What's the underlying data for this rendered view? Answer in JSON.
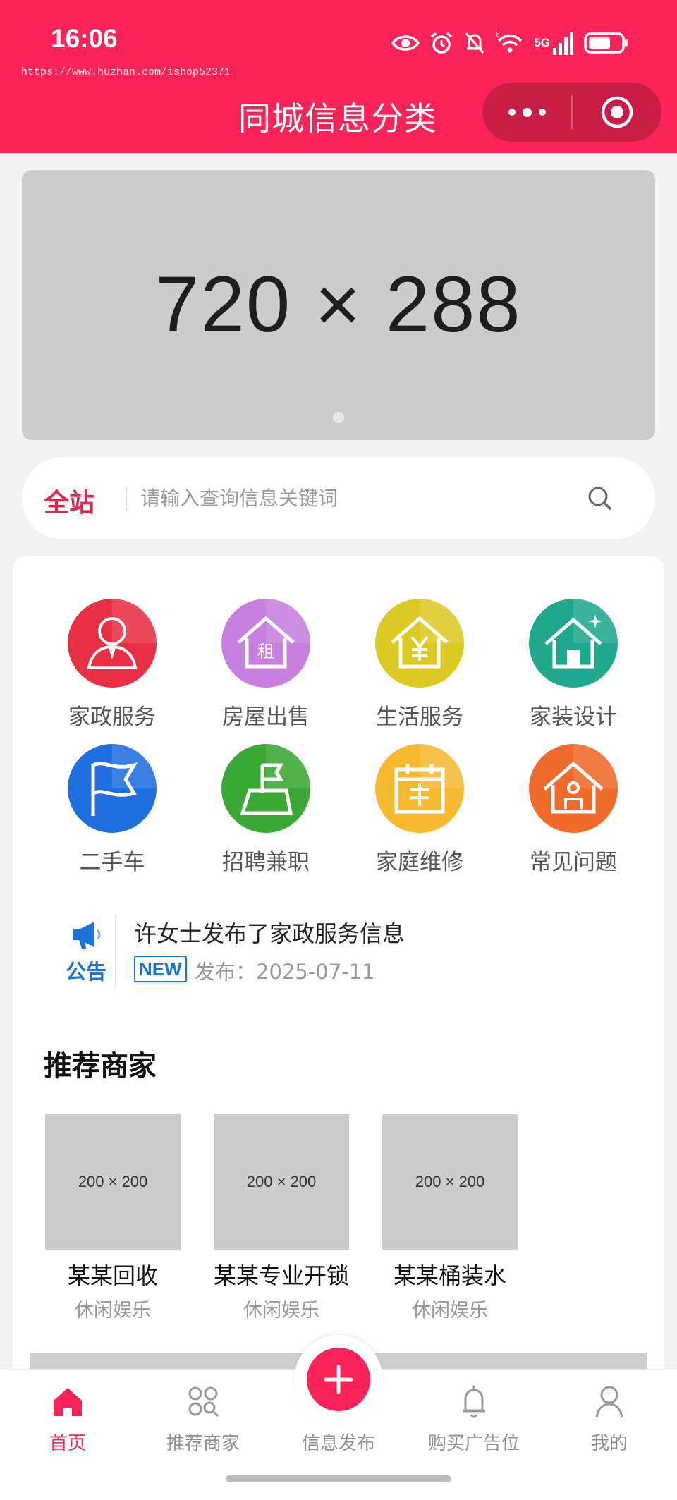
{
  "status_bar": {
    "time": "16:06",
    "network_label": "5G",
    "icons": [
      "eye-icon",
      "alarm-icon",
      "mute-bell-icon",
      "wifi-icon",
      "signal-icon",
      "battery-icon"
    ]
  },
  "url_watermark": "https://www.huzhan.com/ishop52371",
  "header": {
    "title": "同城信息分类",
    "more_icon": "more-dots-icon",
    "close_icon": "target-circle-icon",
    "bg_color": "#fc2358"
  },
  "banner": {
    "placeholder_text": "720 × 288"
  },
  "search": {
    "scope": "全站",
    "placeholder": "请输入查询信息关键词",
    "icon": "search-icon"
  },
  "categories": [
    {
      "label": "家政服务",
      "icon": "housekeeper-icon",
      "color": "#e92f44"
    },
    {
      "label": "房屋出售",
      "icon": "rent-house-icon",
      "color": "#c77fe0"
    },
    {
      "label": "生活服务",
      "icon": "yuan-house-icon",
      "color": "#ddc923"
    },
    {
      "label": "家装设计",
      "icon": "sparkle-house-icon",
      "color": "#20a88e"
    },
    {
      "label": "二手车",
      "icon": "flag-icon",
      "color": "#1f6fe0"
    },
    {
      "label": "招聘兼职",
      "icon": "flag-field-icon",
      "color": "#3aa834"
    },
    {
      "label": "家庭维修",
      "icon": "calendar-box-icon",
      "color": "#f5b82f"
    },
    {
      "label": "常见问题",
      "icon": "house-person-icon",
      "color": "#f06a2a"
    }
  ],
  "notice": {
    "tag": "公告",
    "icon": "megaphone-icon",
    "title": "许女士发布了家政服务信息",
    "badge": "NEW",
    "date_text": "发布：2025-07-11"
  },
  "recommended": {
    "title": "推荐商家",
    "merchants": [
      {
        "image_text": "200 × 200",
        "name": "某某回收",
        "category": "休闲娱乐"
      },
      {
        "image_text": "200 × 200",
        "name": "某某专业开锁",
        "category": "休闲娱乐"
      },
      {
        "image_text": "200 × 200",
        "name": "某某桶装水",
        "category": "休闲娱乐"
      }
    ]
  },
  "tabbar": {
    "tabs": [
      {
        "label": "首页",
        "icon": "home-icon",
        "active": true
      },
      {
        "label": "推荐商家",
        "icon": "apps-icon",
        "active": false
      },
      {
        "label": "信息发布",
        "icon": "plus-icon",
        "active": false
      },
      {
        "label": "购买广告位",
        "icon": "bell-icon",
        "active": false
      },
      {
        "label": "我的",
        "icon": "user-icon",
        "active": false
      }
    ]
  }
}
